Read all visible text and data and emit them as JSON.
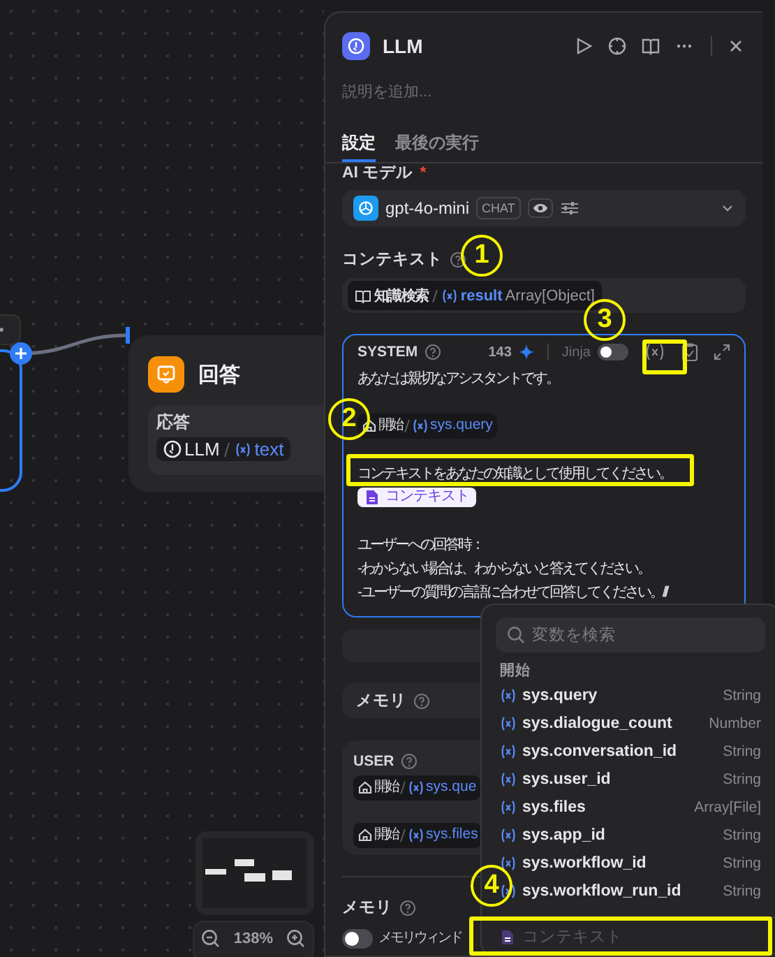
{
  "canvas": {
    "answer_node": {
      "title": "回答",
      "field_label": "応答",
      "ref": {
        "node": "LLM",
        "var": "text"
      }
    },
    "zoom": "138%"
  },
  "panel": {
    "title": "LLM",
    "description_placeholder": "説明を追加...",
    "tabs": [
      {
        "label": "設定",
        "selected": true
      },
      {
        "label": "最後の実行",
        "selected": false
      }
    ],
    "model": {
      "label": "AI モデル",
      "required_mark": "*",
      "name": "gpt-4o-mini",
      "badge": "CHAT"
    },
    "context": {
      "label": "コンテキスト",
      "ref": {
        "node": "知識検索",
        "var": "result",
        "type": "Array[Object]"
      }
    },
    "system": {
      "role": "SYSTEM",
      "count": "143",
      "jinja_label": "Jinja",
      "jinja_on": false,
      "lines": [
        {
          "kind": "text",
          "text": "あなたは親切なアシスタントです。"
        },
        {
          "kind": "blank"
        },
        {
          "kind": "var",
          "node": "開始",
          "var": "sys.query"
        },
        {
          "kind": "blank"
        },
        {
          "kind": "text",
          "text": "コンテキストをあなたの知識として使用してください。"
        },
        {
          "kind": "context",
          "text": "コンテキスト"
        },
        {
          "kind": "blank"
        },
        {
          "kind": "text",
          "text": "ユーザーへの回答時："
        },
        {
          "kind": "text",
          "text": "- わからない場合は、わからないと答えてください。"
        },
        {
          "kind": "text",
          "text": "- ユーザーの質問の言語に合わせて回答してください。///"
        }
      ]
    },
    "memory_row": {
      "label": "メモリ"
    },
    "user": {
      "role": "USER",
      "lines": [
        {
          "kind": "var",
          "node": "開始",
          "var": "sys.que"
        },
        {
          "kind": "blank"
        },
        {
          "kind": "var",
          "node": "開始",
          "var": "sys.files"
        }
      ]
    },
    "memory": {
      "label": "メモリ",
      "window_label": "メモリウィンド",
      "window_on": false
    }
  },
  "popup": {
    "placeholder": "変数を検索",
    "group": "開始",
    "items": [
      {
        "name": "sys.query",
        "type": "String"
      },
      {
        "name": "sys.dialogue_count",
        "type": "Number"
      },
      {
        "name": "sys.conversation_id",
        "type": "String"
      },
      {
        "name": "sys.user_id",
        "type": "String"
      },
      {
        "name": "sys.files",
        "type": "Array[File]"
      },
      {
        "name": "sys.app_id",
        "type": "String"
      },
      {
        "name": "sys.workflow_id",
        "type": "String"
      },
      {
        "name": "sys.workflow_run_id",
        "type": "String"
      }
    ],
    "context_item": {
      "label": "コンテキスト",
      "disabled": true
    }
  },
  "annotations": [
    {
      "kind": "circle",
      "label": "1"
    },
    {
      "kind": "circle",
      "label": "3"
    },
    {
      "kind": "box"
    },
    {
      "kind": "circle",
      "label": "2"
    },
    {
      "kind": "box"
    },
    {
      "kind": "circle",
      "label": "4"
    },
    {
      "kind": "box"
    }
  ]
}
